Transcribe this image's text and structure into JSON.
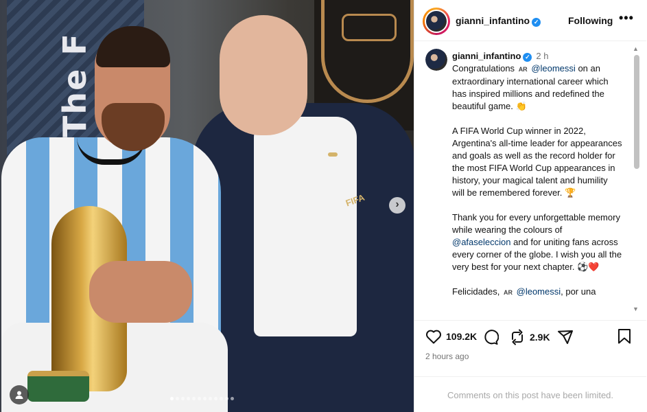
{
  "media": {
    "banner_text": "The F",
    "lapel_text": "FIFA",
    "carousel": {
      "total_slides": 12,
      "active_index": 0
    },
    "next_icon": "chevron-right-icon",
    "tag_icon": "person-icon"
  },
  "header": {
    "username": "gianni_infantino",
    "following_label": "Following",
    "more_label": "•••"
  },
  "caption": {
    "username": "gianni_infantino",
    "time": "2 h",
    "ar_badge": "AR",
    "paragraph1": {
      "before": "Congratulations",
      "mention": "@leomessi",
      "after": "on an extraordinary international career which has inspired millions and redefined the beautiful game. 👏"
    },
    "paragraph2": "A FIFA World Cup winner in 2022, Argentina's all-time leader for appearances and goals as well as the record holder for the most FIFA World Cup appearances in history, your magical talent and humility will be remembered forever. 🏆",
    "paragraph3": {
      "before": "Thank you for every unforgettable memory while wearing the colours of",
      "mention": "@afaseleccion",
      "after": "and for uniting fans across every corner of the globe. I wish you all the very best for your next chapter. ⚽❤️"
    },
    "paragraph4": {
      "before": "Felicidades,",
      "mention": "@leomessi",
      "after": ", por una"
    }
  },
  "actions": {
    "like_count": "109.2K",
    "repost_count": "2.9K",
    "timestamp": "2 hours ago"
  },
  "comments_notice": "Comments on this post have been limited.",
  "colors": {
    "accent_link": "#00376b",
    "verified": "#1f8ef1",
    "muted": "#737373"
  }
}
